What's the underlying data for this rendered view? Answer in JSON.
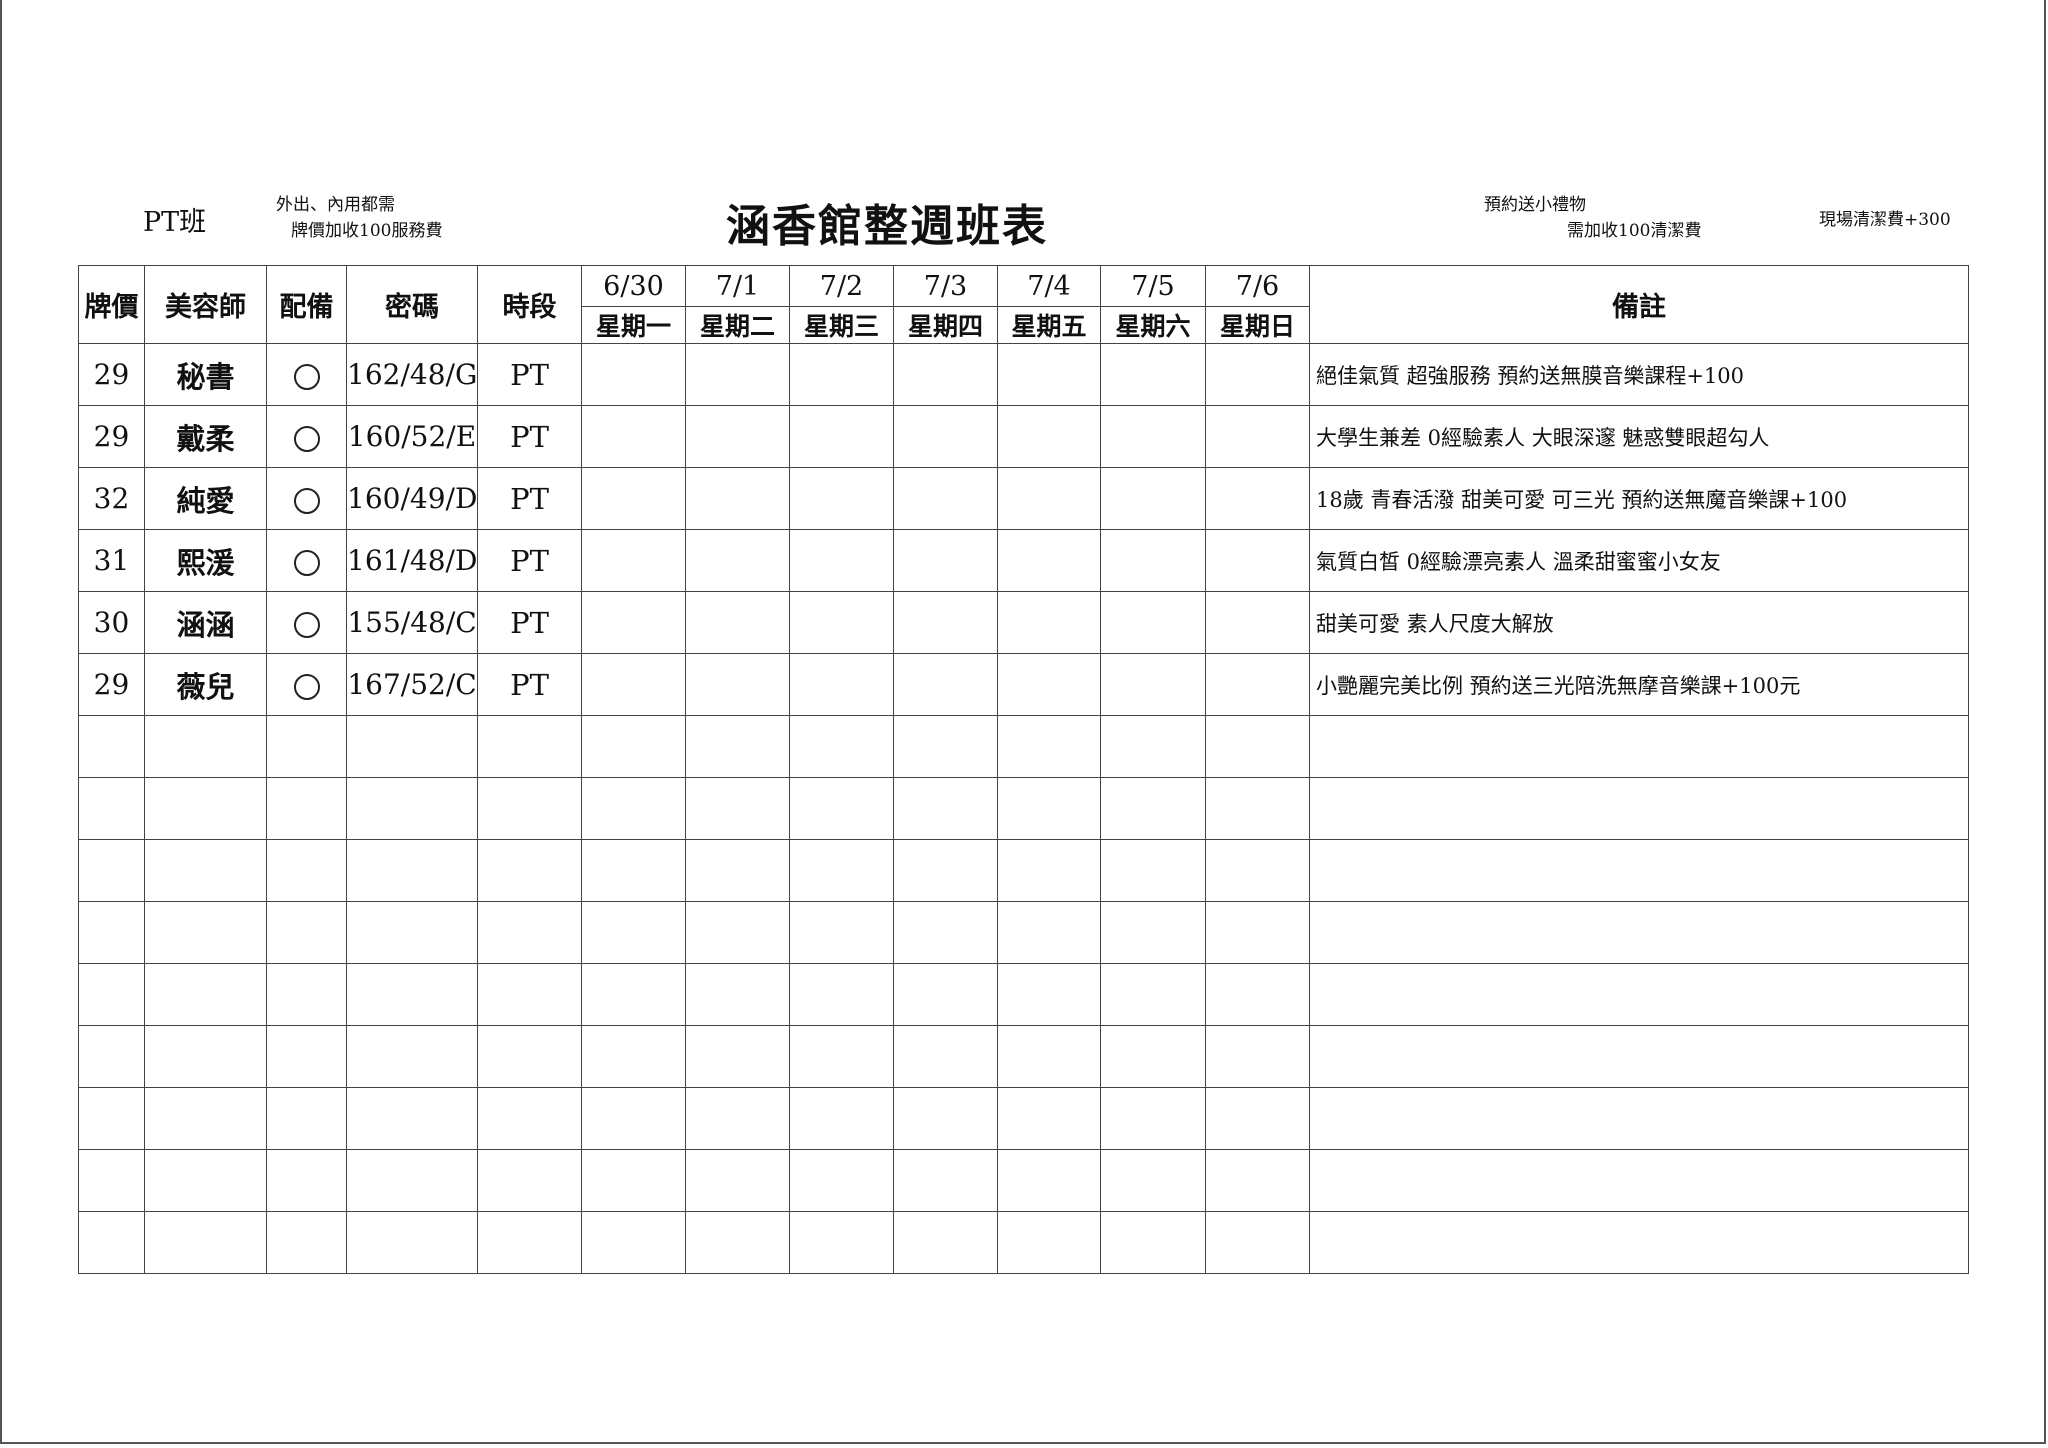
{
  "header": {
    "class_label": "PT班",
    "note_left_line1": "外出、內用都需",
    "note_left_line2": "牌價加收100服務費",
    "title": "涵香館整週班表",
    "note_right_line1": "預約送小禮物",
    "note_right_line2": "需加收100清潔費",
    "note_far_right": "現場清潔費+300"
  },
  "columns": {
    "price": "牌價",
    "beautician": "美容師",
    "equipment": "配備",
    "code": "密碼",
    "period": "時段",
    "remarks": "備註"
  },
  "days": [
    {
      "date": "6/30",
      "weekday": "星期一"
    },
    {
      "date": "7/1",
      "weekday": "星期二"
    },
    {
      "date": "7/2",
      "weekday": "星期三"
    },
    {
      "date": "7/3",
      "weekday": "星期四"
    },
    {
      "date": "7/4",
      "weekday": "星期五"
    },
    {
      "date": "7/5",
      "weekday": "星期六"
    },
    {
      "date": "7/6",
      "weekday": "星期日"
    }
  ],
  "rows": [
    {
      "price": "29",
      "name": "秘書",
      "code": "162/48/G",
      "period": "PT",
      "remark": "絕佳氣質 超強服務 預約送無膜音樂課程+100"
    },
    {
      "price": "29",
      "name": "戴柔",
      "code": "160/52/E",
      "period": "PT",
      "remark": "大學生兼差 0經驗素人 大眼深邃 魅惑雙眼超勾人"
    },
    {
      "price": "32",
      "name": "純愛",
      "code": "160/49/D",
      "period": "PT",
      "remark": "18歲 青春活潑 甜美可愛 可三光 預約送無魔音樂課+100"
    },
    {
      "price": "31",
      "name": "熙湲",
      "code": "161/48/D",
      "period": "PT",
      "remark": "氣質白皙 0經驗漂亮素人 溫柔甜蜜蜜小女友"
    },
    {
      "price": "30",
      "name": "涵涵",
      "code": "155/48/C",
      "period": "PT",
      "remark": "甜美可愛 素人尺度大解放"
    },
    {
      "price": "29",
      "name": "薇兒",
      "code": "167/52/C",
      "period": "PT",
      "remark": "小艷麗完美比例 預約送三光陪洗無摩音樂課+100元"
    }
  ]
}
